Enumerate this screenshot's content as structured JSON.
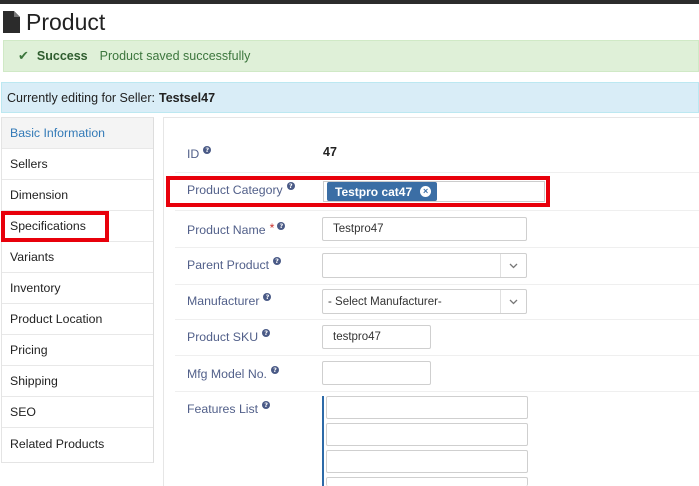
{
  "page": {
    "title": "Product"
  },
  "alert": {
    "label": "Success",
    "message": "Product saved successfully"
  },
  "seller_bar": {
    "prefix": "Currently editing for Seller:",
    "seller": "Testsel47"
  },
  "sidebar": {
    "items": [
      {
        "label": "Basic Information",
        "active": true
      },
      {
        "label": "Sellers"
      },
      {
        "label": "Dimension"
      },
      {
        "label": "Specifications",
        "highlighted": true
      },
      {
        "label": "Variants"
      },
      {
        "label": "Inventory"
      },
      {
        "label": "Product Location"
      },
      {
        "label": "Pricing"
      },
      {
        "label": "Shipping"
      },
      {
        "label": "SEO"
      },
      {
        "label": "Related Products"
      }
    ]
  },
  "form": {
    "id": {
      "label": "ID",
      "value": "47"
    },
    "category": {
      "label": "Product Category",
      "tag": "Testpro cat47"
    },
    "name": {
      "label": "Product Name",
      "required_mark": "*",
      "value": "Testpro47"
    },
    "parent": {
      "label": "Parent Product",
      "value": ""
    },
    "manufacturer": {
      "label": "Manufacturer",
      "value": "- Select Manufacturer-"
    },
    "sku": {
      "label": "Product SKU",
      "value": "testpro47"
    },
    "mfg_model": {
      "label": "Mfg Model No.",
      "value": ""
    },
    "features": {
      "label": "Features List",
      "values": [
        "",
        "",
        "",
        ""
      ]
    },
    "help_glyph": "?"
  },
  "colors": {
    "success_bg": "#dff0d8",
    "info_bg": "#d9edf7",
    "highlight": "#e8000b",
    "tag_bg": "#3b6ea5",
    "label_color": "#52608a"
  },
  "icons": {
    "title_icon": "document-icon",
    "alert_icon": "check-icon",
    "help_icon": "question-circle-icon",
    "tag_remove": "close-circle-icon",
    "select_caret": "chevron-down-icon"
  }
}
